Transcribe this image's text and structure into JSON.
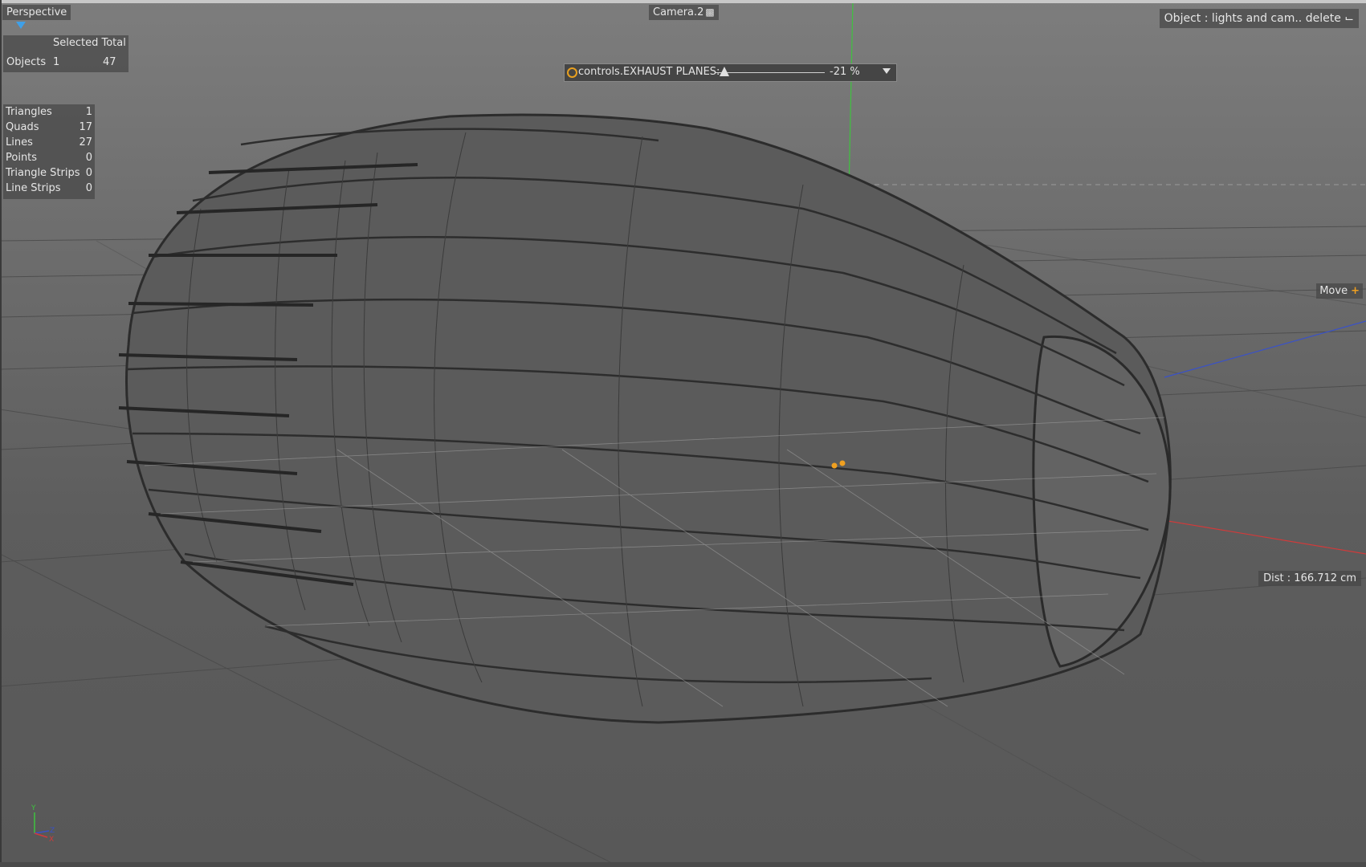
{
  "viewport": {
    "view_name": "Perspective",
    "camera_name": "Camera.2",
    "object_info": "Object : lights and cam.. delete",
    "move_label": "Move",
    "dist_label": "Dist : 166.712 cm"
  },
  "stats": {
    "header": "Selected Total",
    "objects_label": "Objects",
    "objects_selected": "1",
    "objects_total": "47",
    "geometry": [
      {
        "label": "Triangles",
        "value": "1"
      },
      {
        "label": "Quads",
        "value": "17"
      },
      {
        "label": "Lines",
        "value": "27"
      },
      {
        "label": "Points",
        "value": "0"
      },
      {
        "label": "Triangle Strips",
        "value": "0"
      },
      {
        "label": "Line Strips",
        "value": "0"
      }
    ]
  },
  "control": {
    "label": "controls.EXHAUST PLANES:",
    "value_text": "-21 %",
    "value": -0.21
  },
  "axes": {
    "y": "Y",
    "z": "Z",
    "x": "X"
  },
  "colors": {
    "y_axis": "#3fc23f",
    "x_axis": "#d23a3a",
    "z_axis": "#3a52c8",
    "accent": "#f0a020",
    "view_indicator": "#3fa0e8"
  }
}
